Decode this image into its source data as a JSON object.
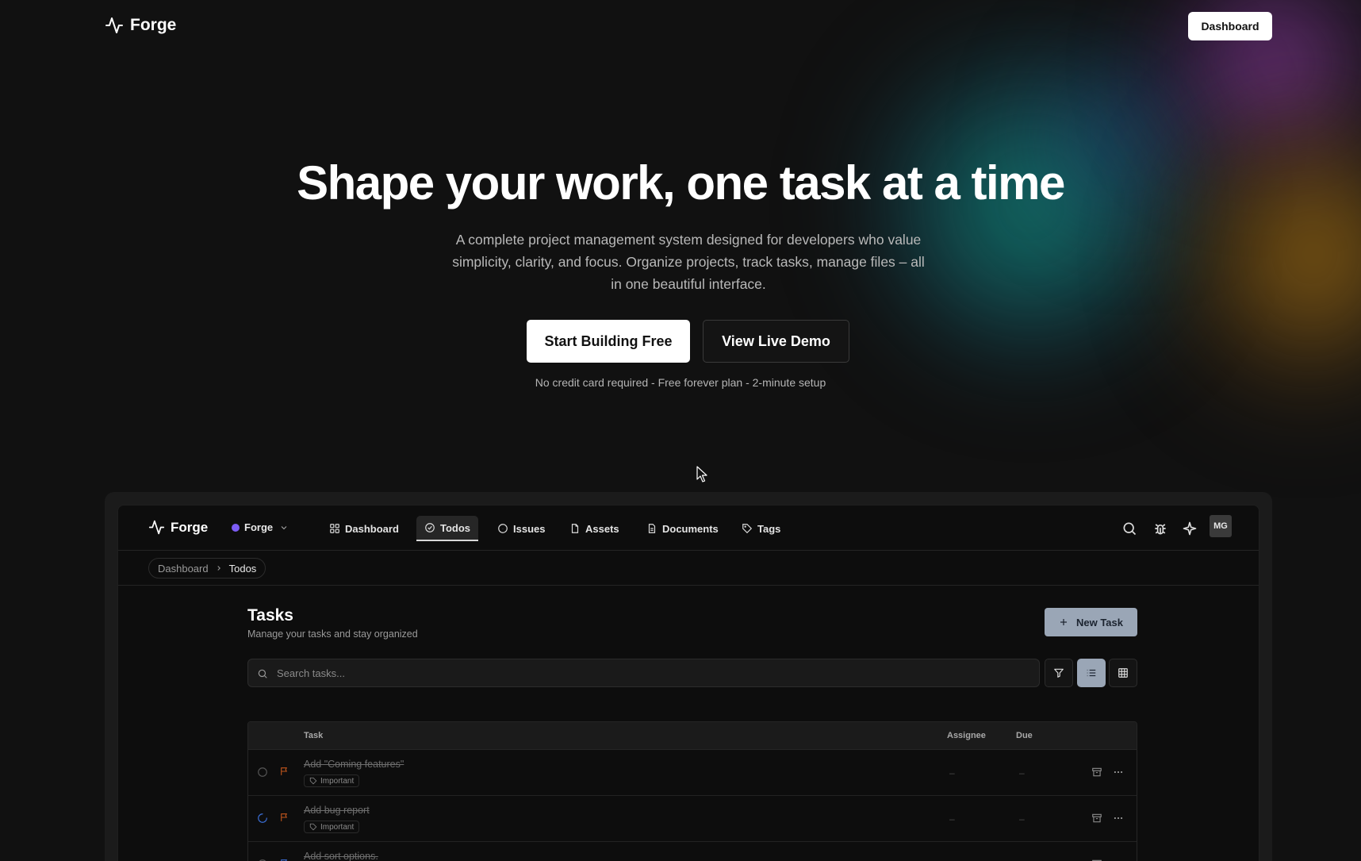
{
  "brand": {
    "name": "Forge"
  },
  "header": {
    "dashboard_label": "Dashboard"
  },
  "hero": {
    "title": "Shape your work, one task at a time",
    "subtitle": "A complete project management system designed for developers who value simplicity, clarity, and focus. Organize projects, track tasks, manage files – all in one beautiful interface.",
    "primary_cta": "Start Building Free",
    "secondary_cta": "View Live Demo",
    "note": "No credit card required - Free forever plan - 2-minute setup"
  },
  "app": {
    "brand": "Forge",
    "workspace": {
      "name": "Forge",
      "color": "#7c5cf5"
    },
    "nav": [
      {
        "label": "Dashboard",
        "icon": "grid-icon",
        "active": false
      },
      {
        "label": "Todos",
        "icon": "check-circle-icon",
        "active": true
      },
      {
        "label": "Issues",
        "icon": "alert-circle-icon",
        "active": false
      },
      {
        "label": "Assets",
        "icon": "file-icon",
        "active": false
      },
      {
        "label": "Documents",
        "icon": "document-icon",
        "active": false
      },
      {
        "label": "Tags",
        "icon": "tag-icon",
        "active": false
      }
    ],
    "user_initials": "MG",
    "breadcrumb": [
      "Dashboard",
      "Todos"
    ],
    "page_title": "Tasks",
    "page_subtitle": "Manage your tasks and stay organized",
    "new_task_label": "New Task",
    "search": {
      "placeholder": "Search tasks..."
    },
    "view_mode": "list",
    "table": {
      "columns": {
        "task": "Task",
        "assignee": "Assignee",
        "due": "Due"
      },
      "rows": [
        {
          "name": "Add \"Coming features\"",
          "tag": "Important",
          "assignee": "–",
          "due": "–",
          "status": "todo"
        },
        {
          "name": "Add bug report",
          "tag": "Important",
          "assignee": "–",
          "due": "–",
          "status": "in-progress"
        },
        {
          "name": "Add sort options.",
          "tag": "",
          "assignee": "",
          "due": "",
          "status": "todo"
        }
      ]
    }
  },
  "colors": {
    "accent": "#9aa6b6",
    "flag": "#c2561c",
    "background": "#111111"
  }
}
